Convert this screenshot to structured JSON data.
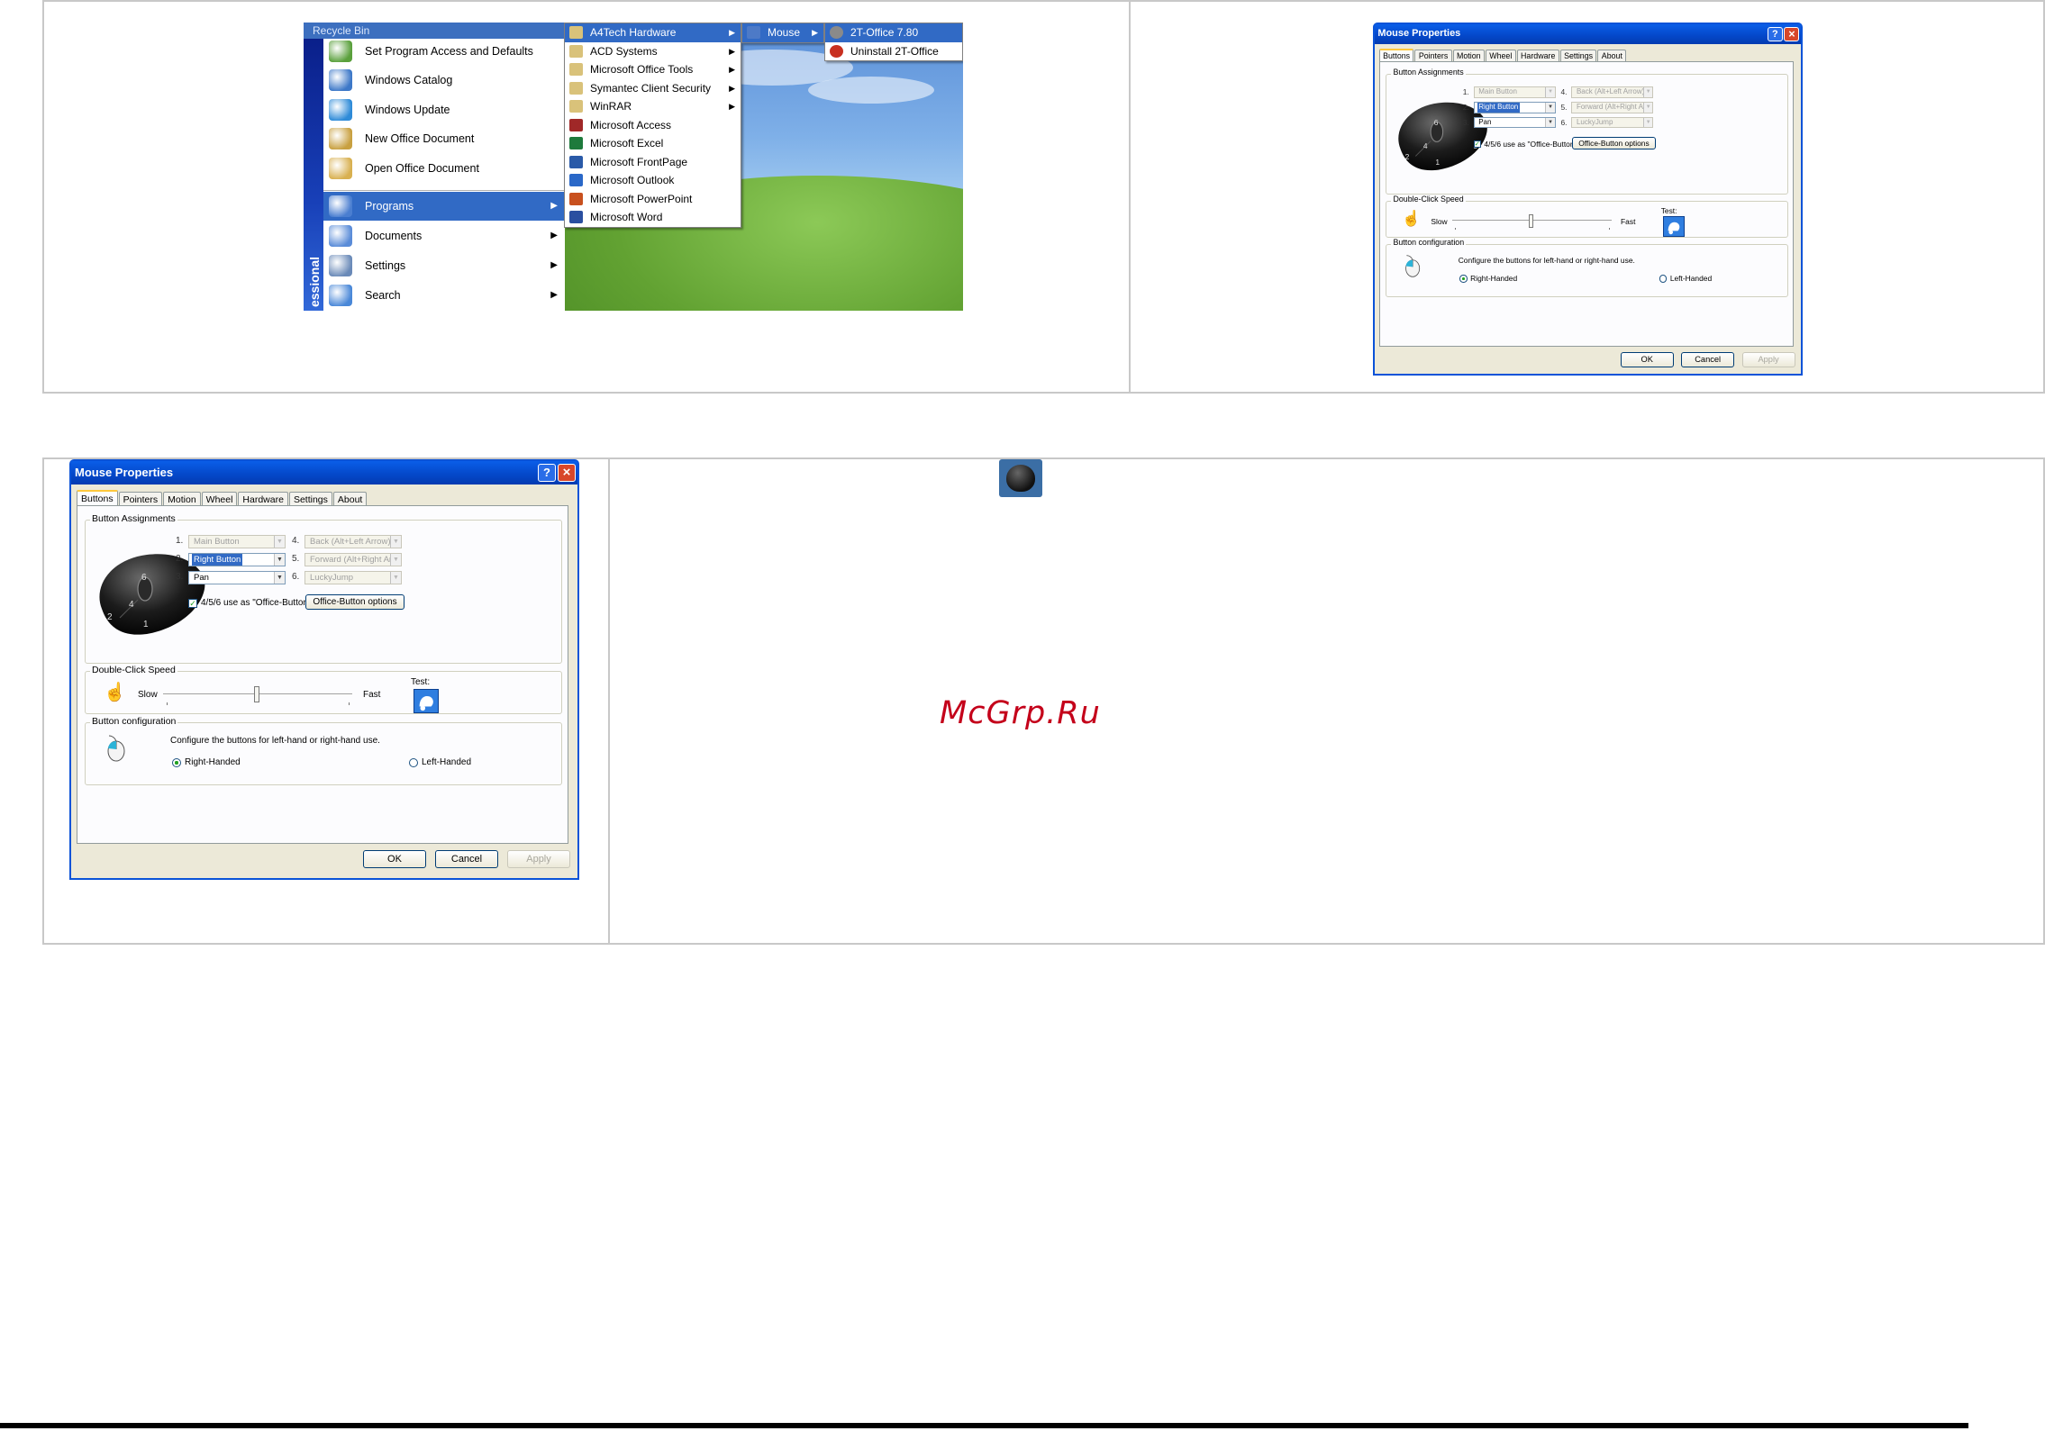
{
  "start_menu": {
    "recycle_label": "Recycle Bin",
    "band_text": "essional",
    "items": [
      {
        "label": "Set Program Access and Defaults",
        "icon": "program-access-icon",
        "color": "#5aa03c"
      },
      {
        "label": "Windows Catalog",
        "icon": "windows-catalog-icon",
        "color": "#3d78c8"
      },
      {
        "label": "Windows Update",
        "icon": "windows-update-icon",
        "color": "#2e8bd8"
      },
      {
        "label": "New Office Document",
        "icon": "new-office-document-icon",
        "color": "#c8a040"
      },
      {
        "label": "Open Office Document",
        "icon": "open-office-document-icon",
        "color": "#d8b050"
      },
      {
        "label": "Programs",
        "icon": "programs-icon",
        "color": "#4a7ed0"
      },
      {
        "label": "Documents",
        "icon": "documents-icon",
        "color": "#5a8cd8"
      },
      {
        "label": "Settings",
        "icon": "settings-icon",
        "color": "#6a8ab8"
      },
      {
        "label": "Search",
        "icon": "search-icon",
        "color": "#4a88d8"
      }
    ]
  },
  "programs_menu": {
    "items": [
      {
        "label": "A4Tech Hardware",
        "submenu": true,
        "icon": "folder-icon"
      },
      {
        "label": "ACD Systems",
        "submenu": true,
        "icon": "folder-icon"
      },
      {
        "label": "Microsoft Office Tools",
        "submenu": true,
        "icon": "folder-icon"
      },
      {
        "label": "Symantec Client Security",
        "submenu": true,
        "icon": "folder-icon"
      },
      {
        "label": "WinRAR",
        "submenu": true,
        "icon": "folder-icon"
      },
      {
        "label": "Microsoft Access",
        "submenu": false,
        "icon": "access-icon"
      },
      {
        "label": "Microsoft Excel",
        "submenu": false,
        "icon": "excel-icon"
      },
      {
        "label": "Microsoft FrontPage",
        "submenu": false,
        "icon": "frontpage-icon"
      },
      {
        "label": "Microsoft Outlook",
        "submenu": false,
        "icon": "outlook-icon"
      },
      {
        "label": "Microsoft PowerPoint",
        "submenu": false,
        "icon": "powerpoint-icon"
      },
      {
        "label": "Microsoft Word",
        "submenu": false,
        "icon": "word-icon"
      }
    ]
  },
  "a4tech_menu": {
    "items": [
      {
        "label": "Mouse",
        "submenu": true
      }
    ]
  },
  "mouse_menu": {
    "items": [
      {
        "label": "2T-Office 7.80"
      },
      {
        "label": "Uninstall 2T-Office"
      }
    ]
  },
  "dialog": {
    "title": "Mouse Properties",
    "help": "?",
    "close": "×",
    "tabs": [
      "Buttons",
      "Pointers",
      "Motion",
      "Wheel",
      "Hardware",
      "Settings",
      "About"
    ],
    "active_tab": "Buttons",
    "button_assignments": {
      "legend": "Button Assignments",
      "rows": [
        {
          "num": "1.",
          "value": "Main Button",
          "state": "disabled"
        },
        {
          "num": "2.",
          "value": "Right Button",
          "state": "selected"
        },
        {
          "num": "3.",
          "value": "Pan",
          "state": "normal"
        },
        {
          "num": "4.",
          "value": "Back (Alt+Left Arrow)",
          "state": "disabled"
        },
        {
          "num": "5.",
          "value": "Forward (Alt+Right Arrow)",
          "state": "disabled"
        },
        {
          "num": "6.",
          "value": "LuckyJump",
          "state": "disabled"
        }
      ],
      "office_checkbox": "4/5/6 use as \"Office-Button\"",
      "office_checked": true,
      "office_button": "Office-Button options"
    },
    "double_click": {
      "legend": "Double-Click Speed",
      "slow": "Slow",
      "fast": "Fast",
      "test": "Test:",
      "level": 0.5
    },
    "configuration": {
      "legend": "Button configuration",
      "desc": "Configure the buttons for left-hand or right-hand use.",
      "right": "Right-Handed",
      "left": "Left-Handed",
      "selected": "right"
    },
    "ok": "OK",
    "cancel": "Cancel",
    "apply": "Apply",
    "mouse_labels": [
      "6",
      "2",
      "5",
      "1",
      "4"
    ]
  },
  "watermark": "McGrp.Ru"
}
